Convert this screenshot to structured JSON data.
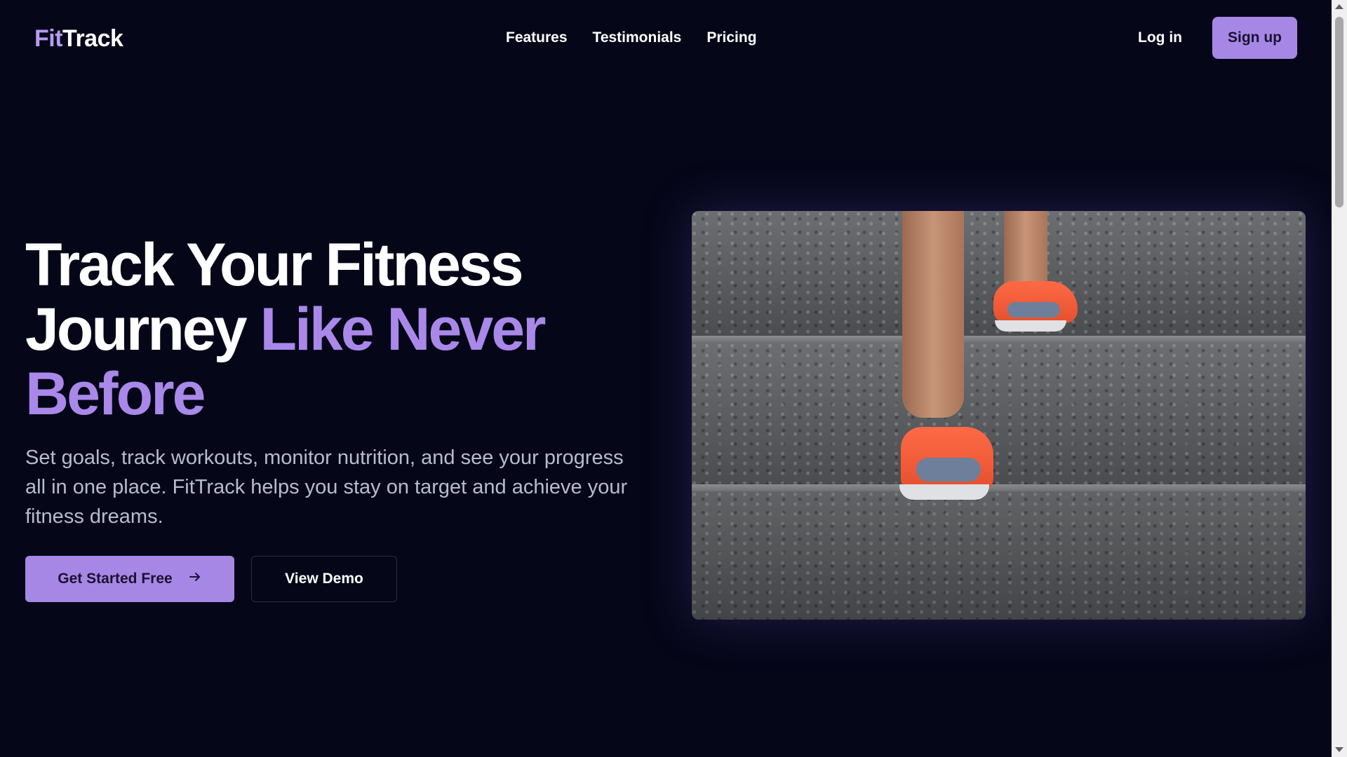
{
  "header": {
    "logo_part1": "Fit",
    "logo_part2": "Track",
    "nav": [
      "Features",
      "Testimonials",
      "Pricing"
    ],
    "login_label": "Log in",
    "signup_label": "Sign up"
  },
  "hero": {
    "headline_line1": "Track Your Fitness",
    "headline_line2_plain": "Journey ",
    "headline_line2_accent": "Like Never",
    "headline_line3_accent": "Before",
    "subtitle": "Set goals, track workouts, monitor nutrition, and see your progress all in one place. FitTrack helps you stay on target and achieve your fitness dreams.",
    "primary_button": "Get Started Free",
    "primary_button_icon": "arrow-right-icon",
    "secondary_button": "View Demo",
    "image_alt": "runner climbing concrete steps in orange sneakers"
  },
  "colors": {
    "background": "#050718",
    "accent": "#a787e6",
    "text_muted": "#b7bccb"
  }
}
